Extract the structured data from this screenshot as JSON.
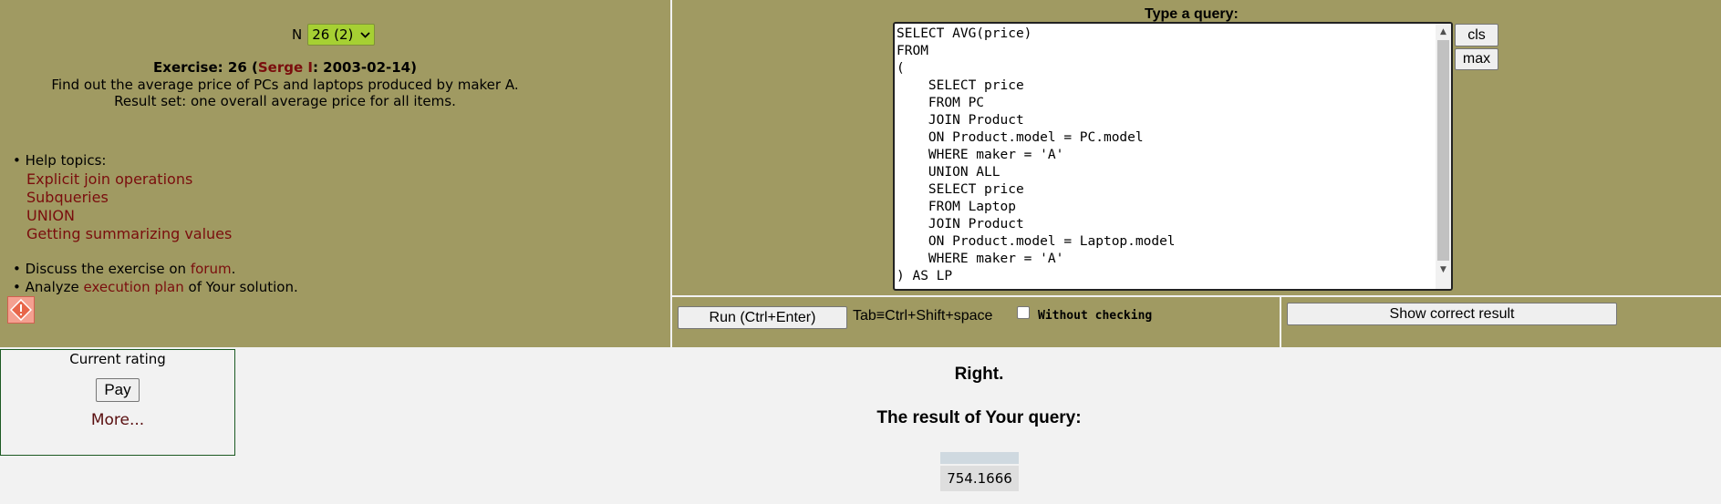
{
  "exercise": {
    "n_label": "N",
    "n_selected": "26 (2)",
    "prefix": "Exercise: 26 (",
    "author": "Serge I",
    "date_part": ": 2003-02-14)",
    "description": "Find out the average price of PCs and laptops produced by maker A.",
    "result_set": "Result set: one overall average price for all items."
  },
  "help": {
    "label": "• Help topics:",
    "topics": [
      "Explicit join operations",
      "Subqueries",
      "UNION",
      "Getting summarizing values"
    ]
  },
  "discuss": {
    "prefix": "• Discuss the exercise on ",
    "link": "forum",
    "suffix": "."
  },
  "analyze": {
    "prefix": "• Analyze ",
    "link": "execution plan",
    "suffix": " of Your solution."
  },
  "rating": {
    "title": "Current rating",
    "pay": "Pay",
    "more": "More..."
  },
  "query": {
    "title": "Type a query:",
    "text": "SELECT AVG(price)\nFROM\n(\n    SELECT price\n    FROM PC\n    JOIN Product\n    ON Product.model = PC.model\n    WHERE maker = 'A'\n    UNION ALL\n    SELECT price\n    FROM Laptop\n    JOIN Product\n    ON Product.model = Laptop.model\n    WHERE maker = 'A'\n) AS LP",
    "cls": "cls",
    "max": "max"
  },
  "controls": {
    "run": "Run (Ctrl+Enter)",
    "tab_hint": "Tab≡Ctrl+Shift+space",
    "without_checking": "Without checking",
    "show_correct": "Show correct result"
  },
  "result": {
    "status": "Right.",
    "heading": "The result of Your query:",
    "value": "754.1666"
  },
  "colors": {
    "panel": "#a09a62",
    "link": "#7a0d0d",
    "select": "#a6d033"
  }
}
